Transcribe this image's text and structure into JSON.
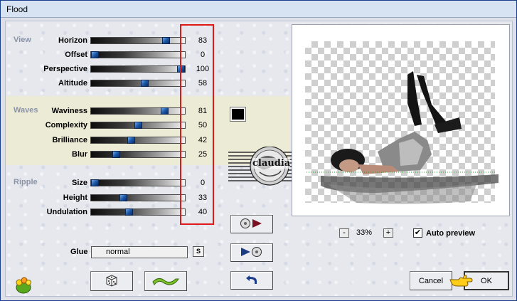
{
  "window": {
    "title": "Flood"
  },
  "groups": {
    "view": "View",
    "waves": "Waves",
    "ripple": "Ripple"
  },
  "sliders": [
    {
      "label": "Horizon",
      "value": "83",
      "fraction": 0.83
    },
    {
      "label": "Offset",
      "value": "0",
      "fraction": 0.0
    },
    {
      "label": "Perspective",
      "value": "100",
      "fraction": 1.0
    },
    {
      "label": "Altitude",
      "value": "58",
      "fraction": 0.58
    },
    {
      "label": "Waviness",
      "value": "81",
      "fraction": 0.81
    },
    {
      "label": "Complexity",
      "value": "50",
      "fraction": 0.5
    },
    {
      "label": "Brilliance",
      "value": "42",
      "fraction": 0.42
    },
    {
      "label": "Blur",
      "value": "25",
      "fraction": 0.25
    },
    {
      "label": "Size",
      "value": "0",
      "fraction": 0.0
    },
    {
      "label": "Height",
      "value": "33",
      "fraction": 0.33
    },
    {
      "label": "Undulation",
      "value": "40",
      "fraction": 0.4
    }
  ],
  "color_swatch": "#000000",
  "highlight_color": "#e01818",
  "glue": {
    "label": "Glue",
    "value": "normal",
    "s_button": "S"
  },
  "zoom": {
    "minus": "-",
    "value": "33%",
    "plus": "+"
  },
  "auto_preview": {
    "label": "Auto preview",
    "checked": true,
    "mark": "✔"
  },
  "watermark_text": "claudia",
  "buttons": {
    "cancel": "Cancel",
    "ok": "OK"
  },
  "icons": [
    "frog-logo-icon",
    "dice-icon",
    "wave-icon",
    "undo-icon",
    "load-preset-icon",
    "save-preset-icon",
    "hand-pointer-icon"
  ]
}
